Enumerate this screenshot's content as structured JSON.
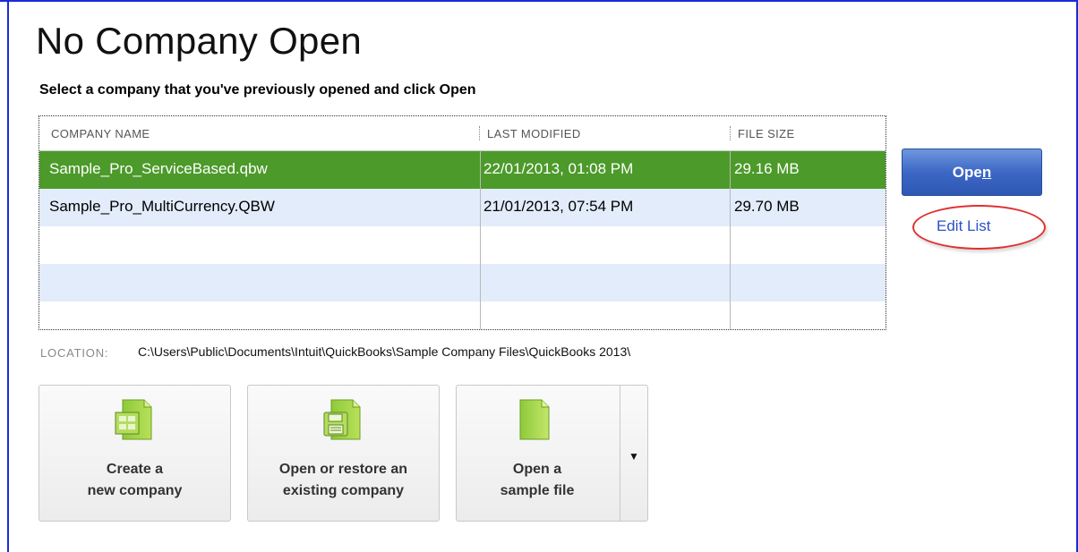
{
  "page": {
    "title": "No Company Open",
    "subtitle": "Select a company that you've previously opened and click Open"
  },
  "company_list": {
    "columns": [
      "COMPANY NAME",
      "LAST MODIFIED",
      "FILE SIZE"
    ],
    "rows": [
      {
        "name": "Sample_Pro_ServiceBased.qbw",
        "modified": "22/01/2013, 01:08 PM",
        "size": "29.16 MB",
        "selected": true
      },
      {
        "name": "Sample_Pro_MultiCurrency.QBW",
        "modified": "21/01/2013, 07:54 PM",
        "size": "29.70 MB",
        "selected": false
      },
      {
        "name": "",
        "modified": "",
        "size": "",
        "selected": false
      },
      {
        "name": "",
        "modified": "",
        "size": "",
        "selected": false
      },
      {
        "name": "",
        "modified": "",
        "size": "",
        "selected": false
      }
    ]
  },
  "actions": {
    "open_label_prefix": "Ope",
    "open_label_mnemonic": "n",
    "edit_list_label": "Edit List"
  },
  "location": {
    "label": "LOCATION:",
    "value": "C:\\Users\\Public\\Documents\\Intuit\\QuickBooks\\Sample Company Files\\QuickBooks 2013\\"
  },
  "tiles": [
    {
      "line1": "Create a",
      "line2": "new company",
      "icon": "new-company-icon"
    },
    {
      "line1": "Open or restore an",
      "line2": "existing company",
      "icon": "open-restore-icon"
    },
    {
      "line1": "Open a",
      "line2": "sample file",
      "icon": "sample-file-icon",
      "dropdown_arrow": "▼"
    }
  ],
  "colors": {
    "selected_row": "#4c9a2a",
    "alt_row": "#e2ecfa",
    "frame": "#1a2bd8",
    "open_button": "#3c67c4",
    "edit_link": "#2a52c9",
    "highlight_oval": "#e03030"
  }
}
